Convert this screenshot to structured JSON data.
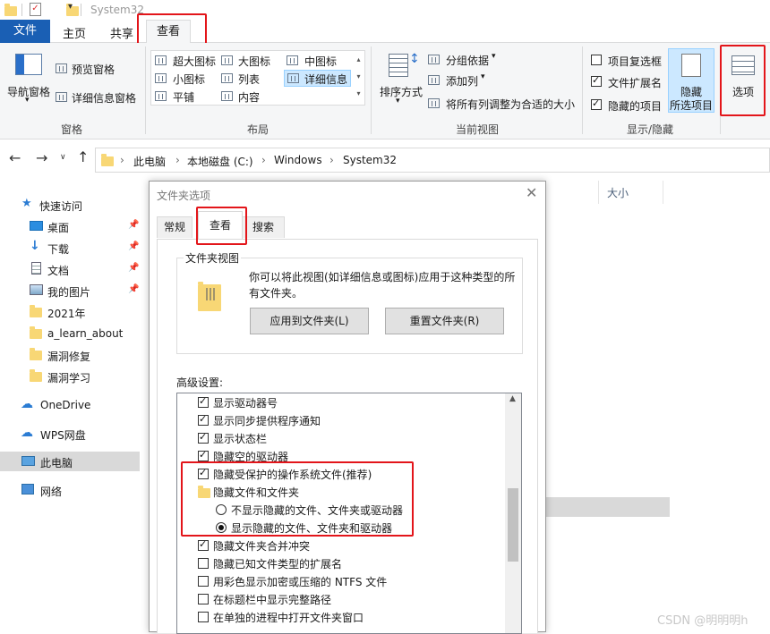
{
  "window": {
    "title": "System32"
  },
  "ribbon": {
    "tabs": {
      "file": "文件",
      "home": "主页",
      "share": "共享",
      "view": "查看"
    },
    "panes": {
      "nav_pane": "导航窗格",
      "preview": "预览窗格",
      "details": "详细信息窗格",
      "group": "窗格"
    },
    "layout": {
      "xl_icons": "超大图标",
      "large_icons": "大图标",
      "medium_icons": "中图标",
      "small_icons": "小图标",
      "list": "列表",
      "details": "详细信息",
      "tiles": "平铺",
      "content": "内容",
      "group": "布局"
    },
    "current_view": {
      "sort": "排序方式",
      "group_by": "分组依据",
      "add_col": "添加列",
      "fit_cols": "将所有列调整为合适的大小",
      "group": "当前视图"
    },
    "show_hide": {
      "item_checkbox": "项目复选框",
      "extensions": "文件扩展名",
      "hidden_items": "隐藏的项目",
      "hide_selected_1": "隐藏",
      "hide_selected_2": "所选项目",
      "group": "显示/隐藏"
    },
    "options": "选项"
  },
  "address": {
    "parts": [
      "此电脑",
      "本地磁盘 (C:)",
      "Windows",
      "System32"
    ]
  },
  "column_header": {
    "size": "大小"
  },
  "sidebar": {
    "quick_access": "快速访问",
    "items": [
      "桌面",
      "下载",
      "文档",
      "我的图片",
      "2021年",
      "a_learn_about",
      "漏洞修复",
      "漏洞学习"
    ],
    "onedrive": "OneDrive",
    "wps": "WPS网盘",
    "this_pc": "此电脑",
    "network": "网络"
  },
  "dialog": {
    "title": "文件夹选项",
    "tabs": {
      "general": "常规",
      "view": "查看",
      "search": "搜索"
    },
    "folder_view": {
      "legend": "文件夹视图",
      "desc_1": "你可以将此视图(如详细信息或图标)应用于这种类型的所",
      "desc_2": "有文件夹。",
      "apply": "应用到文件夹(L)",
      "reset": "重置文件夹(R)"
    },
    "advanced_label": "高级设置:",
    "settings": [
      {
        "label": "显示驱动器号",
        "kind": "check",
        "checked": true
      },
      {
        "label": "显示同步提供程序通知",
        "kind": "check",
        "checked": true
      },
      {
        "label": "显示状态栏",
        "kind": "check",
        "checked": true
      },
      {
        "label": "隐藏空的驱动器",
        "kind": "check",
        "checked": true
      },
      {
        "label": "隐藏受保护的操作系统文件(推荐)",
        "kind": "check",
        "checked": true
      },
      {
        "label": "隐藏文件和文件夹",
        "kind": "folder",
        "checked": false
      },
      {
        "label": "不显示隐藏的文件、文件夹或驱动器",
        "kind": "radio",
        "checked": false
      },
      {
        "label": "显示隐藏的文件、文件夹和驱动器",
        "kind": "radio",
        "checked": true
      },
      {
        "label": "隐藏文件夹合并冲突",
        "kind": "check",
        "checked": true
      },
      {
        "label": "隐藏已知文件类型的扩展名",
        "kind": "check",
        "checked": false
      },
      {
        "label": "用彩色显示加密或压缩的 NTFS 文件",
        "kind": "check",
        "checked": false
      },
      {
        "label": "在标题栏中显示完整路径",
        "kind": "check",
        "checked": false
      },
      {
        "label": "在单独的进程中打开文件夹窗口",
        "kind": "check",
        "checked": false
      }
    ]
  },
  "watermark": "CSDN @明明明h",
  "colors": {
    "file_tab": "#1a5fb4",
    "highlight": "#e3151a",
    "selected": "#cce8ff"
  }
}
